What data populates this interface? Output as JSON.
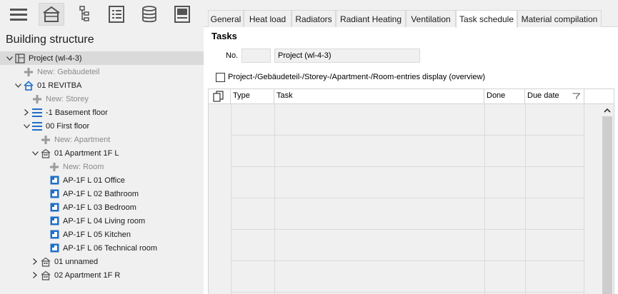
{
  "toolbar": {
    "buttons": [
      {
        "icon": "menu-icon"
      },
      {
        "icon": "building-icon",
        "active": true
      },
      {
        "icon": "hierarchy-icon"
      },
      {
        "icon": "list-icon"
      },
      {
        "icon": "database-icon"
      },
      {
        "icon": "panel-icon"
      }
    ]
  },
  "left": {
    "title": "Building structure",
    "tree": [
      {
        "label": "Project (wl-4-3)",
        "icon": "project-icon",
        "expander": "collapse",
        "level": 0,
        "selected": true
      },
      {
        "label": "New: Gebäudeteil",
        "icon": "plus-icon",
        "level": 1,
        "dim": true
      },
      {
        "label": "01 REVITBA",
        "icon": "house-icon",
        "expander": "collapse",
        "level": 1
      },
      {
        "label": "New: Storey",
        "icon": "plus-icon",
        "level": 2,
        "dim": true
      },
      {
        "label": "-1 Basement floor",
        "icon": "storey-icon",
        "expander": "expand",
        "level": 2
      },
      {
        "label": "00 First floor",
        "icon": "storey-icon",
        "expander": "collapse",
        "level": 2
      },
      {
        "label": "New: Apartment",
        "icon": "plus-icon",
        "level": 3,
        "dim": true
      },
      {
        "label": "01 Apartment 1F L",
        "icon": "apartment-icon",
        "expander": "collapse",
        "level": 3
      },
      {
        "label": "New: Room",
        "icon": "plus-icon",
        "level": 4,
        "dim": true
      },
      {
        "label": "AP-1F L 01 Office",
        "icon": "room-icon",
        "level": 4
      },
      {
        "label": "AP-1F L 02 Bathroom",
        "icon": "room-icon",
        "level": 4
      },
      {
        "label": "AP-1F L 03 Bedroom",
        "icon": "room-icon",
        "level": 4
      },
      {
        "label": "AP-1F L 04 Living room",
        "icon": "room-icon",
        "level": 4
      },
      {
        "label": "AP-1F L 05 Kitchen",
        "icon": "room-icon",
        "level": 4
      },
      {
        "label": "AP-1F L 06 Technical room",
        "icon": "room-icon",
        "level": 4
      },
      {
        "label": "01 unnamed",
        "icon": "apartment-icon",
        "expander": "expand",
        "level": 3
      },
      {
        "label": "02 Apartment 1F R",
        "icon": "apartment-icon",
        "expander": "expand",
        "level": 3
      }
    ]
  },
  "tabs": [
    "General",
    "Heat load",
    "Radiators",
    "Radiant Heating",
    "Ventilation",
    "Task schedule",
    "Material compilation"
  ],
  "active_tab": "Task schedule",
  "tasks": {
    "title": "Tasks",
    "no_label": "No.",
    "no_value": "",
    "project_value": "Project (wl-4-3)",
    "checkbox_label": "Project-/Gebäudeteil-/Storey-/Apartment-/Room-entries display (overview)",
    "checkbox_checked": false,
    "columns": [
      "",
      "Type",
      "Task",
      "Done",
      "Due date"
    ],
    "rows": []
  },
  "colors": {
    "accent_blue": "#1e6fc8",
    "panel_bg": "#f0f0f0",
    "selection": "#dadada"
  }
}
